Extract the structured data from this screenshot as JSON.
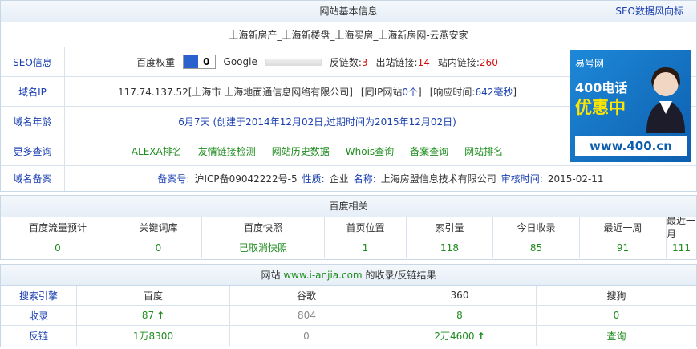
{
  "basic": {
    "header": "网站基本信息",
    "seo_link": "SEO数据风向标",
    "site_title": "上海新房产_上海新楼盘_上海买房_上海新房网-云燕安家",
    "seo_label": "SEO信息",
    "baidu_weight_label": "百度权重",
    "baidu_weight_value": "0",
    "google_label": "Google",
    "backlinks_label": "反链数:",
    "backlinks_value": "3",
    "outbound_label": "出站链接:",
    "outbound_value": "14",
    "internal_label": "站内链接:",
    "internal_value": "260",
    "ip_label": "域名IP",
    "ip_value": "117.74.137.52[上海市 上海地面通信息网络有限公司]",
    "same_ip_prefix": "[同IP网站",
    "same_ip_count": "0个",
    "same_ip_suffix": "]",
    "response_prefix": "[响应时间:",
    "response_value": "642毫秒",
    "response_suffix": "]",
    "age_label": "域名年龄",
    "age_value": "6月7天",
    "age_detail": "(创建于2014年12月02日,过期时间为2015年12月02日)",
    "more_label": "更多查询",
    "more_links": [
      "ALEXA排名",
      "友情链接检测",
      "网站历史数据",
      "Whois查询",
      "备案查询",
      "网站排名"
    ],
    "icp_label": "域名备案",
    "icp_no_label": "备案号:",
    "icp_no": "沪ICP备09042222号-5",
    "nature_label": "性质:",
    "nature": "企业",
    "name_label": "名称:",
    "name": "上海房盟信息技术有限公司",
    "audit_label": "审核时间:",
    "audit_time": "2015-02-11"
  },
  "ad": {
    "brand": "易号网",
    "line1": "400电话",
    "line2": "优惠中",
    "url": "www.400.cn"
  },
  "baidu": {
    "header": "百度相关",
    "columns": [
      "百度流量预计",
      "关键词库",
      "百度快照",
      "首页位置",
      "索引量",
      "今日收录",
      "最近一周",
      "最近一月"
    ],
    "values": [
      "0",
      "0",
      "已取消快照",
      "1",
      "118",
      "85",
      "91",
      "111"
    ]
  },
  "indexing": {
    "header_prefix": "网站",
    "domain": "www.i-anjia.com",
    "header_suffix": "的收录/反链结果",
    "columns": [
      "搜索引擎",
      "百度",
      "谷歌",
      "360",
      "搜狗"
    ],
    "rows": [
      {
        "label": "收录",
        "cells": [
          "87",
          "804",
          "8",
          "0"
        ]
      },
      {
        "label": "反链",
        "cells": [
          "1万8300",
          "0",
          "2万4600",
          "查询"
        ]
      }
    ]
  },
  "colors": {
    "link_blue": "#1a3fb0",
    "value_green": "#1e8c1e",
    "value_red": "#d01010"
  }
}
